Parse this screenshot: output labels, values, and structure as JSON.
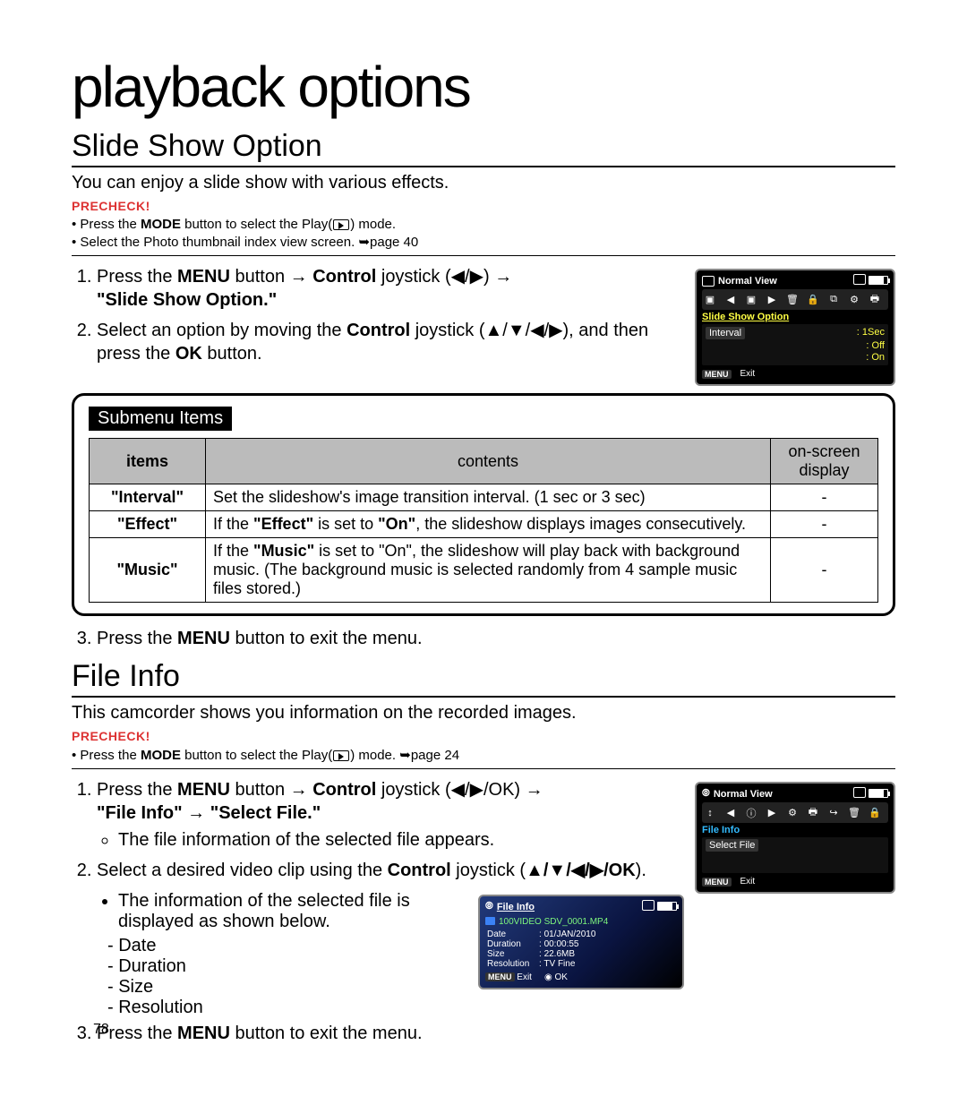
{
  "title": "playback options",
  "slide": {
    "heading": "Slide Show Option",
    "intro": "You can enjoy a slide show with various effects.",
    "precheck_label": "PRECHECK!",
    "precheck": [
      {
        "pre": "Press the ",
        "bold": "MODE",
        "post": " button to select the Play(",
        "post2": ") mode."
      },
      {
        "text": "Select the Photo thumbnail index view screen. ",
        "link": "➥page 40"
      }
    ],
    "step1_a": "Press the ",
    "step1_b": "MENU",
    "step1_c": " button → ",
    "step1_d": "Control",
    "step1_e": " joystick (◀/▶) → ",
    "step1_f": "\"Slide Show Option.\"",
    "step2_a": "Select an option by moving the ",
    "step2_b": "Control",
    "step2_c": " joystick (▲/▼/◀/▶), and then press the ",
    "step2_d": "OK",
    "step2_e": " button.",
    "step3_a": "Press the ",
    "step3_b": "MENU",
    "step3_c": " button to exit the menu."
  },
  "osd1": {
    "mode": "Normal View",
    "heading": "Slide Show Option",
    "rows": [
      {
        "k": "Interval",
        "v": "1Sec"
      },
      {
        "k": "",
        "v": "Off"
      },
      {
        "k": "",
        "v": "On"
      }
    ],
    "exit_btn": "MENU",
    "exit": "Exit"
  },
  "submenu": {
    "label": "Submenu Items",
    "headers": [
      "items",
      "contents",
      "on-screen display"
    ],
    "rows": [
      {
        "item": "\"Interval\"",
        "content": "Set the slideshow's image transition interval. (1 sec or 3 sec)",
        "disp": "-"
      },
      {
        "item": "\"Effect\"",
        "content_pre": "If the ",
        "content_b1": "\"Effect\"",
        "content_mid": " is set to ",
        "content_b2": "\"On\"",
        "content_post": ", the slideshow displays images consecutively.",
        "disp": "-"
      },
      {
        "item": "\"Music\"",
        "content_pre": "If the ",
        "content_b1": "\"Music\"",
        "content_mid": " is set to \"On\", the slideshow will play back with background music. (The background music is selected randomly from 4 sample music files stored.)",
        "disp": "-"
      }
    ]
  },
  "file": {
    "heading": "File Info",
    "intro": "This camcorder shows you information on the recorded images.",
    "precheck_label": "PRECHECK!",
    "precheck_a": "Press the ",
    "precheck_b": "MODE",
    "precheck_c": " button to select the Play(",
    "precheck_d": ") mode. ",
    "precheck_e": "➥page 24",
    "step1_a": "Press the ",
    "step1_b": "MENU",
    "step1_c": " button → ",
    "step1_d": "Control",
    "step1_e": " joystick (◀/▶/OK) → ",
    "step1_f": "\"File Info\" → \"Select File.\"",
    "step1_sub": "The file information of the selected file appears.",
    "step2_a": "Select a desired video clip using the ",
    "step2_b": "Control",
    "step2_c": " joystick (",
    "step2_d": "▲/▼/◀/▶/OK",
    "step2_e": ").",
    "step2_sub": "The information of the selected file is displayed as shown below.",
    "items": [
      "Date",
      "Duration",
      "Size",
      "Resolution"
    ],
    "step3_a": "Press the ",
    "step3_b": "MENU",
    "step3_c": " button to exit the menu."
  },
  "osd2": {
    "mode": "Normal View",
    "heading": "File Info",
    "select": "Select File",
    "exit_btn": "MENU",
    "exit": "Exit"
  },
  "osd3": {
    "title": "File Info",
    "path": "100VIDEO SDV_0001.MP4",
    "fields": [
      {
        "k": "Date",
        "v": "01/JAN/2010"
      },
      {
        "k": "Duration",
        "v": "00:00:55"
      },
      {
        "k": "Size",
        "v": "22.6MB"
      },
      {
        "k": "Resolution",
        "v": "TV Fine"
      }
    ],
    "menu_btn": "MENU",
    "menu": "Exit",
    "ok_ring": "◉",
    "ok": "OK"
  },
  "page_number": "78"
}
